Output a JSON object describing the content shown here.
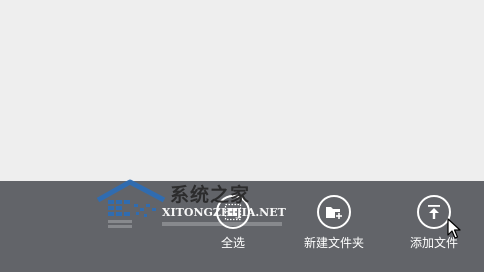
{
  "watermark": {
    "title": "系统之家",
    "subtitle": "XITONGZHIJIA.NET"
  },
  "app_bar": {
    "buttons": [
      {
        "label": "全选",
        "icon": "select-all-icon"
      },
      {
        "label": "新建文件夹",
        "icon": "new-folder-icon"
      },
      {
        "label": "添加文件",
        "icon": "upload-icon"
      }
    ]
  },
  "colors": {
    "content_background": "#eeeeee",
    "app_bar_background": "#626469",
    "icon_stroke": "#ffffff",
    "label_text": "#ffffff",
    "watermark_logo": "#2e6db4"
  }
}
